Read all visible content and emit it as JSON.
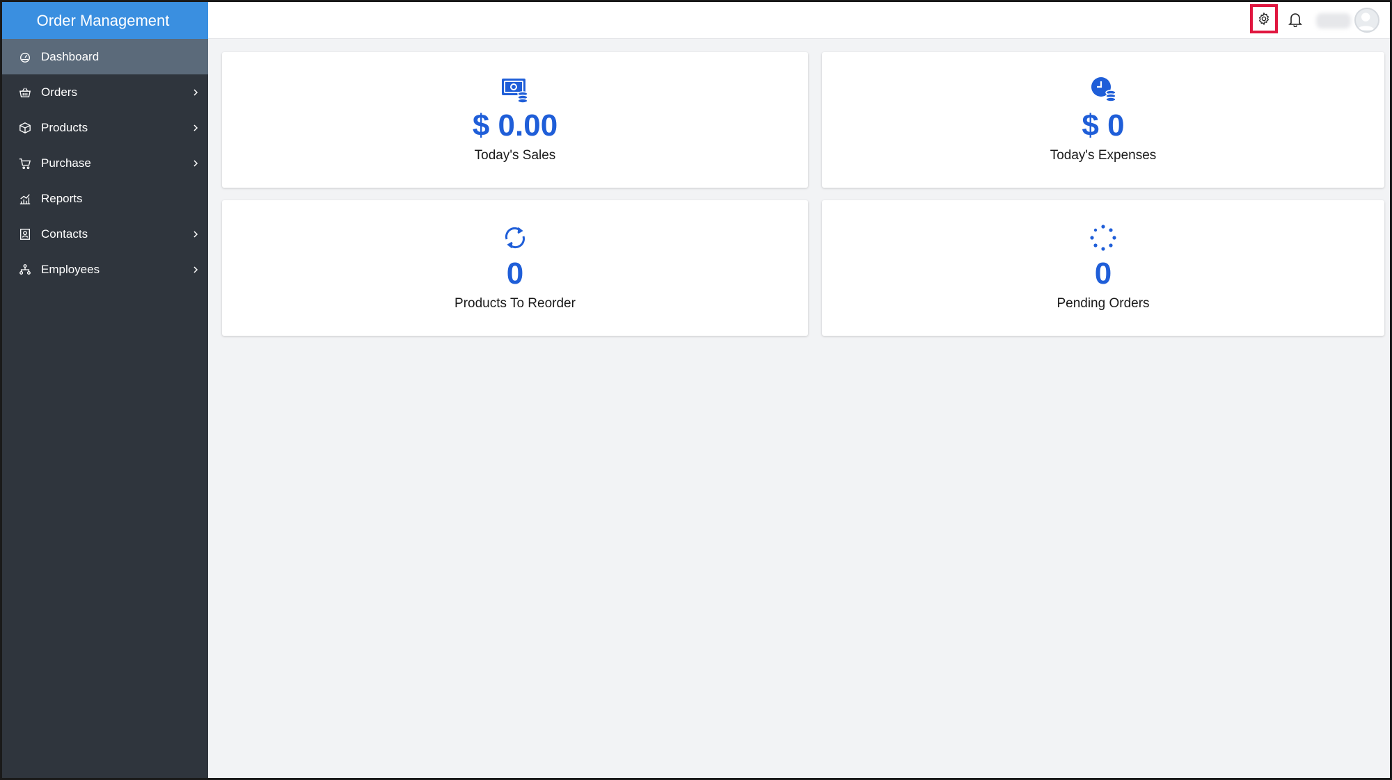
{
  "app": {
    "title": "Order Management"
  },
  "sidebar": {
    "items": [
      {
        "label": "Dashboard",
        "icon": "dashboard-icon",
        "active": true,
        "has_submenu": false
      },
      {
        "label": "Orders",
        "icon": "basket-icon",
        "active": false,
        "has_submenu": true
      },
      {
        "label": "Products",
        "icon": "box-icon",
        "active": false,
        "has_submenu": true
      },
      {
        "label": "Purchase",
        "icon": "cart-icon",
        "active": false,
        "has_submenu": true
      },
      {
        "label": "Reports",
        "icon": "chart-icon",
        "active": false,
        "has_submenu": false
      },
      {
        "label": "Contacts",
        "icon": "contact-book-icon",
        "active": false,
        "has_submenu": true
      },
      {
        "label": "Employees",
        "icon": "org-chart-icon",
        "active": false,
        "has_submenu": true
      }
    ]
  },
  "topbar": {
    "icons": [
      "gear-icon",
      "bell-icon",
      "avatar"
    ],
    "highlight_color": "#e0163f"
  },
  "cards": [
    {
      "value": "$ 0.00",
      "label": "Today's Sales",
      "icon": "money-coins-icon"
    },
    {
      "value": "$ 0",
      "label": "Today's Expenses",
      "icon": "clock-coins-icon"
    },
    {
      "value": "0",
      "label": "Products To Reorder",
      "icon": "refresh-icon"
    },
    {
      "value": "0",
      "label": "Pending Orders",
      "icon": "spinner-icon"
    }
  ],
  "colors": {
    "sidebar_bg": "#2f353d",
    "brand_bg": "#3a8fe0",
    "active_item_bg": "#5b6a7a",
    "accent": "#1f5ed8",
    "content_bg": "#f2f3f5"
  }
}
